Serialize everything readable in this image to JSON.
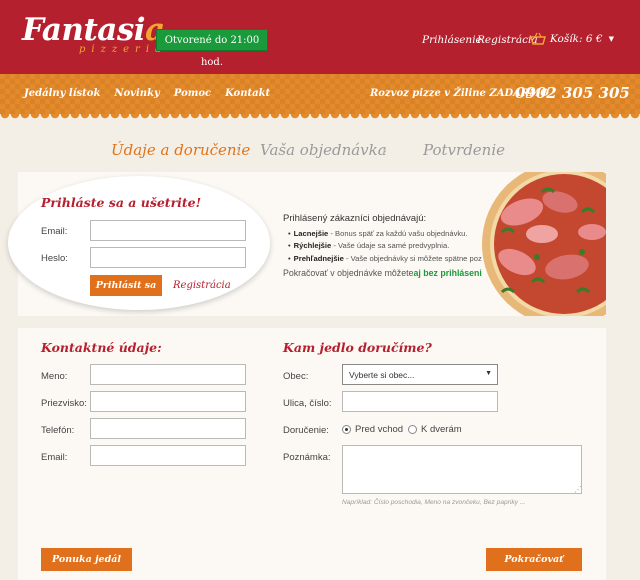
{
  "brand": {
    "name_main": "Fantasi",
    "name_accent": "a",
    "subtitle": "pizzeria"
  },
  "header": {
    "open_badge": "Otvorené do 21:00 hod.",
    "login_link": "Prihlásenie",
    "register_link": "Registrácia",
    "cart_label": "Košík: 6 €"
  },
  "nav": {
    "items": [
      {
        "label": "Jedálny lístok"
      },
      {
        "label": "Novinky"
      },
      {
        "label": "Pomoc"
      },
      {
        "label": "Kontakt"
      }
    ],
    "delivery_text": "Rozvoz pizze v Žiline ZADARMO",
    "phone": "0902 305 305"
  },
  "steps": [
    {
      "label": "Údaje a doručenie",
      "active": true
    },
    {
      "label": "Vaša objednávka",
      "active": false
    },
    {
      "label": "Potvrdenie",
      "active": false
    }
  ],
  "login": {
    "title": "Prihláste sa a ušetrite!",
    "email_label": "Email:",
    "password_label": "Heslo:",
    "submit": "Prihlásit sa",
    "register": "Registrácia"
  },
  "benefits": {
    "title": "Prihlásený zákazníci objednávajú:",
    "items": [
      {
        "strong": "Lacnejšie",
        "text": " - Bonus späť za každú vašu objednávku."
      },
      {
        "strong": "Rýchlejšie",
        "text": " - Vaše údaje sa samé predvyplnia."
      },
      {
        "strong": "Prehľadnejšie",
        "text": " - Vaše objednávky si môžete spätne pozrieť."
      }
    ],
    "continue_text": "Pokračovať v objednávke môžete",
    "continue_link": "aj bez prihlásenia."
  },
  "contact": {
    "title": "Kontaktné údaje:",
    "name_label": "Meno:",
    "surname_label": "Priezvisko:",
    "phone_label": "Telefón:",
    "email_label": "Email:"
  },
  "delivery": {
    "title": "Kam jedlo doručíme?",
    "town_label": "Obec:",
    "town_value": "Vyberte si obec...",
    "street_label": "Ulica, číslo:",
    "delivery_label": "Doručenie:",
    "option_front": "Pred vchod",
    "option_door": "K dverám",
    "note_label": "Poznámka:",
    "note_hint": "Napríklad: Číslo poschodia, Meno na zvončeku, Bez papriky ..."
  },
  "footer": {
    "menu_button": "Ponuka jedál",
    "continue_button": "Pokračovať"
  },
  "colors": {
    "primary": "#b5202e",
    "accent": "#e0701c",
    "badge": "#1a9a3a"
  }
}
